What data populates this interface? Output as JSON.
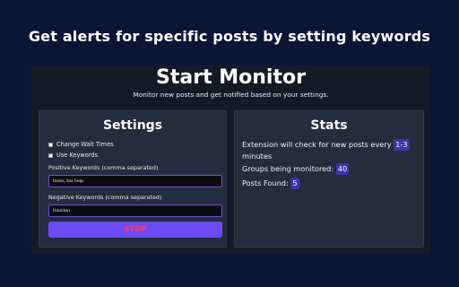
{
  "headline": "Get alerts for specific posts by setting keywords",
  "monitor": {
    "title": "Start Monitor",
    "subtitle": "Monitor new posts and get notified based on your settings."
  },
  "settings": {
    "title": "Settings",
    "change_wait_times": {
      "label": "Change Wait Times",
      "checked": false
    },
    "use_keywords": {
      "label": "Use Keywords",
      "checked": true
    },
    "positive_label": "Positive Keywords (comma separated)",
    "positive_value": "taxes, tax help",
    "negative_label": "Negative Keywords (comma separated)",
    "negative_value": "Houston",
    "stop_label": "STOP"
  },
  "stats": {
    "title": "Stats",
    "check_text_a": "Extension will check for new posts every",
    "check_interval": "1-3",
    "check_text_b": "minutes",
    "groups_label": "Groups being monitored:",
    "groups_count": "40",
    "posts_label": "Posts Found:",
    "posts_count": "5"
  },
  "colors": {
    "background": "#0c1536",
    "accent": "#6c4af7",
    "stop_text": "#ff3b63"
  }
}
